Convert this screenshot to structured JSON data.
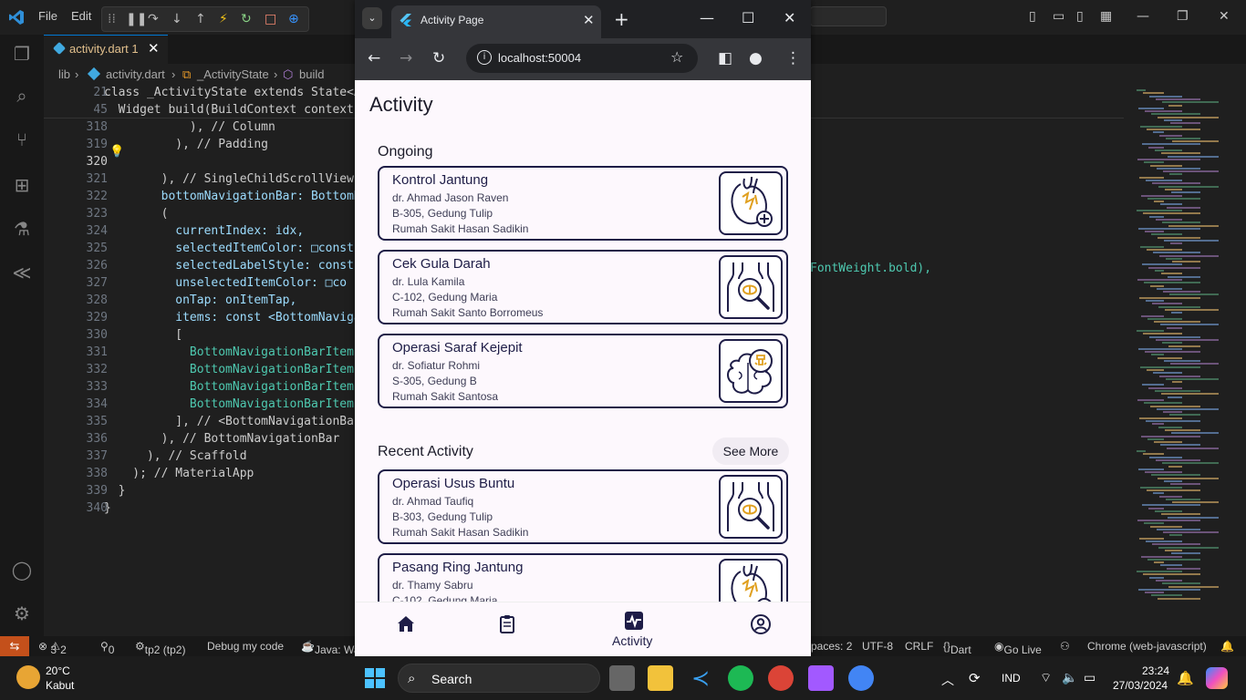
{
  "vscode": {
    "menu": [
      "File",
      "Edit"
    ],
    "tab": {
      "name": "activity.dart",
      "count": "1"
    },
    "breadcrumbs": [
      "lib",
      "activity.dart",
      "_ActivityState",
      "build"
    ],
    "sticky": [
      {
        "line": "21",
        "code": "class _ActivityState extends State<A"
      },
      {
        "line": "45",
        "code": "  Widget build(BuildContext context)"
      }
    ],
    "lines": [
      {
        "n": "318",
        "t": "            ), // Column"
      },
      {
        "n": "319",
        "t": "          ), // Padding"
      },
      {
        "n": "320",
        "t": ""
      },
      {
        "n": "321",
        "t": "        ), // SingleChildScrollView"
      },
      {
        "n": "322",
        "t": "        bottomNavigationBar: BottomN"
      },
      {
        "n": "323",
        "t": "        ("
      },
      {
        "n": "324",
        "t": "          currentIndex: idx,"
      },
      {
        "n": "325",
        "t": "          selectedItemColor: □const"
      },
      {
        "n": "326",
        "t": "          selectedLabelStyle: const"
      },
      {
        "n": "327",
        "t": "          unselectedItemColor: □co"
      },
      {
        "n": "328",
        "t": "          onTap: onItemTap,"
      },
      {
        "n": "329",
        "t": "          items: const <BottomNaviga"
      },
      {
        "n": "330",
        "t": "          ["
      },
      {
        "n": "331",
        "t": "            BottomNavigationBarItem"
      },
      {
        "n": "332",
        "t": "            BottomNavigationBarItem"
      },
      {
        "n": "333",
        "t": "            BottomNavigationBarItem"
      },
      {
        "n": "334",
        "t": "            BottomNavigationBarItem"
      },
      {
        "n": "335",
        "t": "          ], // <BottomNavigationBa"
      },
      {
        "n": "336",
        "t": "        ), // BottomNavigationBar"
      },
      {
        "n": "337",
        "t": "      ), // Scaffold"
      },
      {
        "n": "338",
        "t": "    ); // MaterialApp"
      },
      {
        "n": "339",
        "t": "  }"
      },
      {
        "n": "340",
        "t": "}"
      }
    ],
    "overflow_text": "FontWeight.bold),",
    "status": {
      "errors": "3",
      "warnings": "2",
      "ports": "0",
      "project": "tp2 (tp2)",
      "debug": "Debug my code",
      "java": "Java: Wa",
      "spaces": "paces: 2",
      "encoding": "UTF-8",
      "eol": "CRLF",
      "language": "Dart",
      "golive": "Go Live",
      "device": "Chrome (web-javascript)"
    }
  },
  "chrome": {
    "tab_title": "Activity Page",
    "url": "localhost:50004"
  },
  "app": {
    "title": "Activity",
    "ongoing_title": "Ongoing",
    "recent_title": "Recent Activity",
    "see_more": "See More",
    "ongoing": [
      {
        "title": "Kontrol Jantung",
        "doctor": "dr. Ahmad Jason Raven",
        "room": "B-305, Gedung Tulip",
        "hospital": "Rumah Sakit Hasan Sadikin",
        "icon": "heart-icon"
      },
      {
        "title": "Cek Gula Darah",
        "doctor": "dr. Lula Kamila",
        "room": "C-102, Gedung Maria",
        "hospital": "Rumah Sakit Santo Borromeus",
        "icon": "stomach-magnifier-icon"
      },
      {
        "title": "Operasi Saraf Kejepit",
        "doctor": "dr. Sofiatur Rohmi",
        "room": "S-305, Gedung B",
        "hospital": "Rumah Sakit Santosa",
        "icon": "brain-icon"
      }
    ],
    "recent": [
      {
        "title": "Operasi Usus Buntu",
        "doctor": "dr. Ahmad Taufiq",
        "room": "B-303, Gedung Tulip",
        "hospital": "Rumah Sakit Hasan Sadikin",
        "icon": "stomach-magnifier-icon"
      },
      {
        "title": "Pasang Ring Jantung",
        "doctor": "dr. Thamy Sabru",
        "room": "C-102, Gedung Maria",
        "hospital": "",
        "icon": "heart-icon"
      }
    ],
    "nav": {
      "active_label": "Activity"
    },
    "colors": {
      "primary": "#1e1d47",
      "accent": "#e0a020",
      "background": "#fdf8fd"
    }
  },
  "taskbar": {
    "weather_temp": "20°C",
    "weather_desc": "Kabut",
    "search": "Search",
    "lang": "IND",
    "time": "23:24",
    "date": "27/03/2024"
  }
}
